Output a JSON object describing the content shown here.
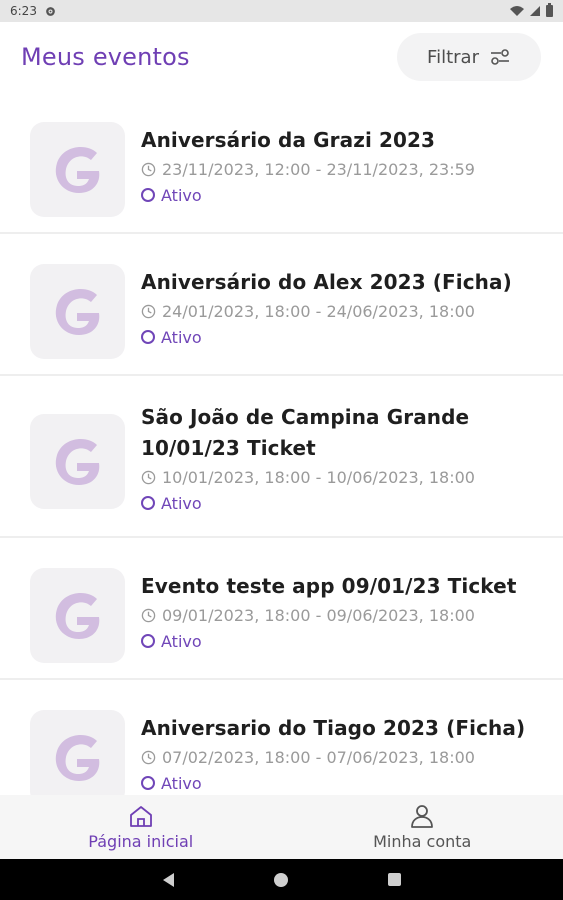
{
  "status_bar": {
    "time": "6:23",
    "icons": [
      "settings-icon",
      "wifi-icon",
      "signal-icon",
      "battery-icon"
    ]
  },
  "header": {
    "title": "Meus eventos",
    "filter_label": "Filtrar",
    "filter_icon": "filter-sliders-icon"
  },
  "colors": {
    "accent": "#6f3fb4",
    "status": "#7046b8",
    "muted_text": "#9a9a9a",
    "thumb_bg": "#f2f1f3",
    "logo": "#d2bde0"
  },
  "events": [
    {
      "title": "Aniversário da Grazi 2023",
      "dates": "23/11/2023, 12:00 - 23/11/2023, 23:59",
      "status": "Ativo"
    },
    {
      "title": "Aniversário do Alex 2023 (Ficha)",
      "dates": "24/01/2023, 18:00 - 24/06/2023, 18:00",
      "status": "Ativo"
    },
    {
      "title_line1": "São João de Campina Grande",
      "title_line2": "10/01/23 Ticket",
      "dates": "10/01/2023, 18:00 - 10/06/2023, 18:00",
      "status": "Ativo"
    },
    {
      "title": "Evento teste app 09/01/23 Ticket",
      "dates": "09/01/2023, 18:00 - 09/06/2023, 18:00",
      "status": "Ativo"
    },
    {
      "title": "Aniversario do Tiago 2023 (Ficha)",
      "dates": "07/02/2023, 18:00 - 07/06/2023, 18:00",
      "status": "Ativo"
    }
  ],
  "bottom_nav": {
    "items": [
      {
        "label": "Página inicial",
        "icon": "home-icon",
        "active": true
      },
      {
        "label": "Minha conta",
        "icon": "user-icon",
        "active": false
      }
    ]
  }
}
